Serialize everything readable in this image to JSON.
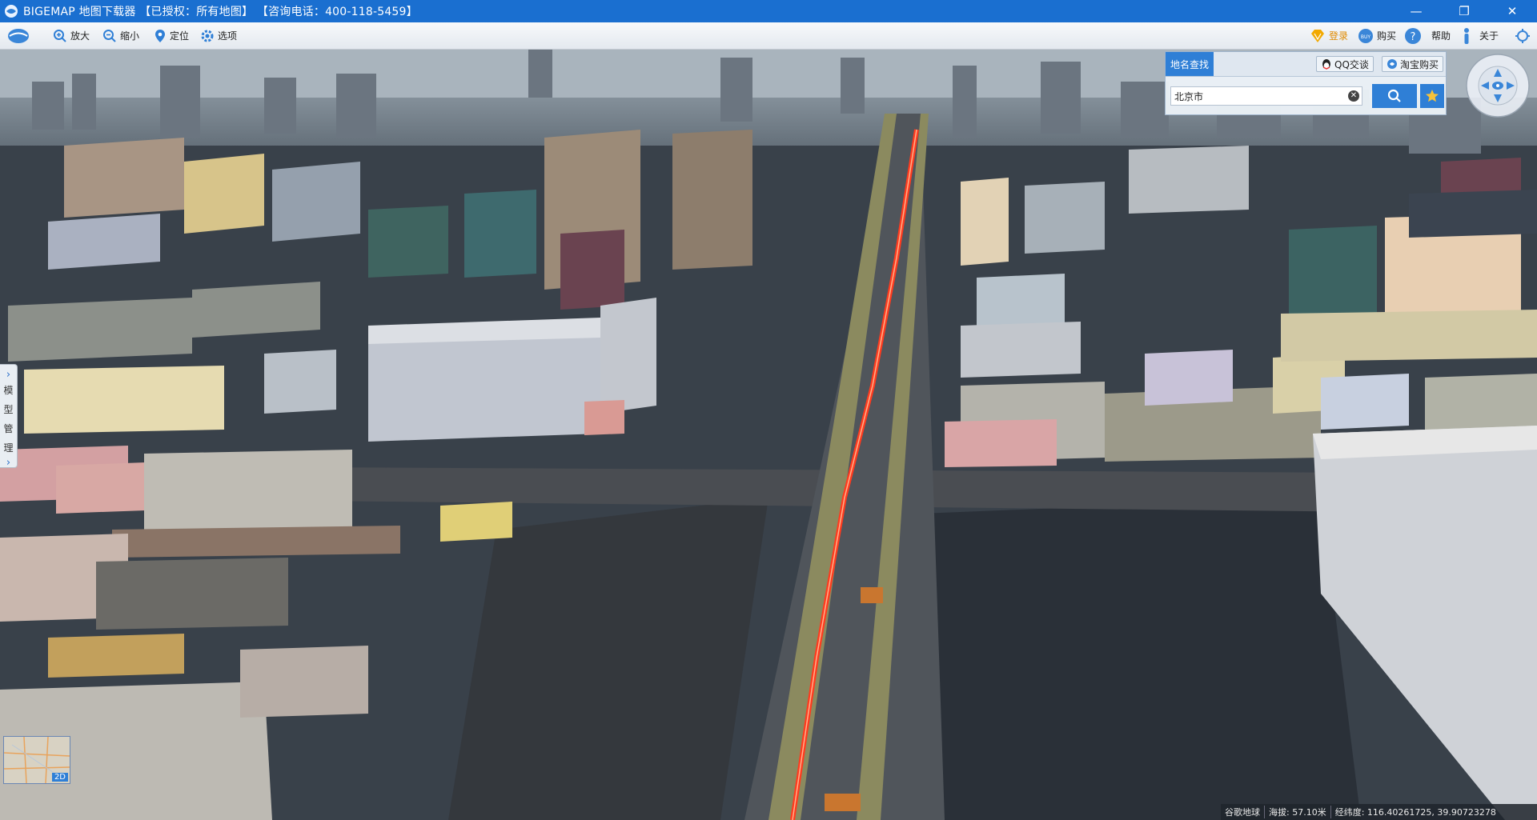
{
  "window": {
    "title": "BIGEMAP 地图下载器 【已授权：所有地图】 【咨询电话：400-118-5459】",
    "controls": {
      "minimize": "—",
      "maximize": "❐",
      "close": "✕"
    }
  },
  "toolbar": {
    "zoom_in": "放大",
    "zoom_out": "缩小",
    "locate": "定位",
    "options": "选项",
    "login": "登录",
    "buy": "购买",
    "help": "帮助",
    "about": "关于"
  },
  "left_panel": {
    "label_chars": [
      "模",
      "型",
      "管",
      "理"
    ],
    "arrow_top": "›",
    "arrow_bottom": "›"
  },
  "search": {
    "tab_label": "地名查找",
    "qq_label": "QQ交谈",
    "taobao_label": "淘宝购买",
    "input_value": "北京市",
    "clear_label": "✕"
  },
  "minimap": {
    "mode_label": "2D"
  },
  "status": {
    "source": "谷歌地球",
    "altitude": "海拔: 57.10米",
    "coords": "经纬度: 116.40261725, 39.90723278"
  },
  "colors": {
    "titlebar": "#1a6fd0",
    "accent": "#2f7fd6",
    "road_highlight": "#ff3b1f"
  }
}
